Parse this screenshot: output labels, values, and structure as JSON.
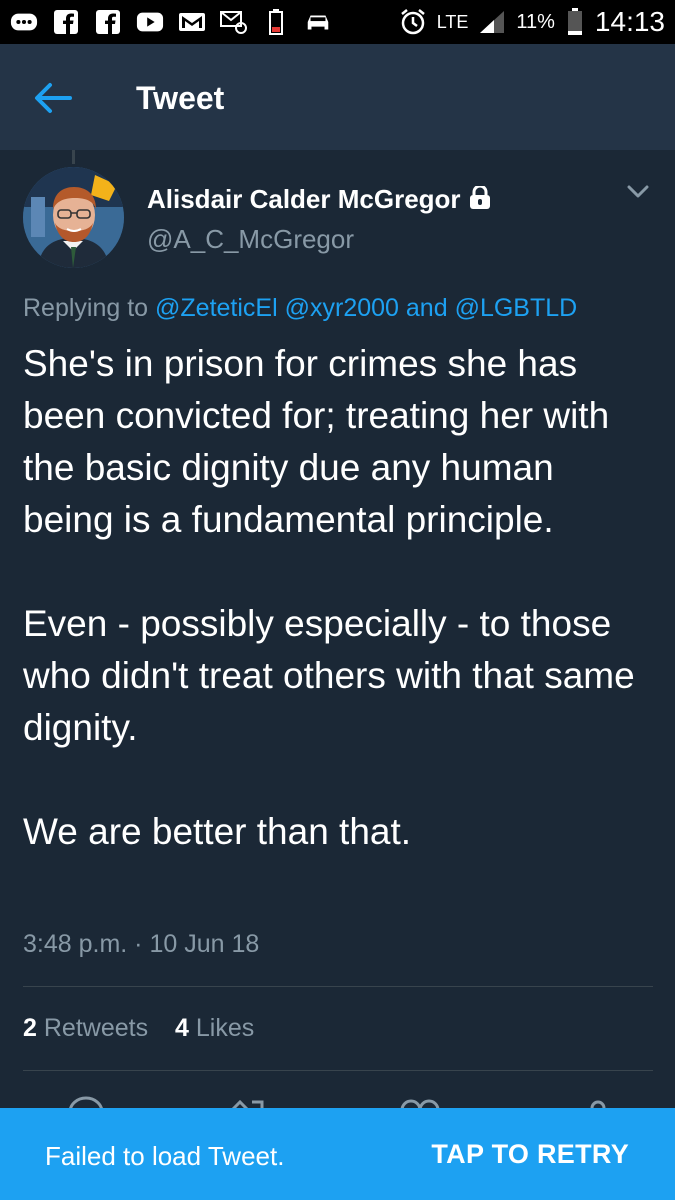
{
  "status_bar": {
    "network": "LTE",
    "battery": "11%",
    "time": "14:13",
    "icons": [
      "chat-bubble-icon",
      "facebook-icon",
      "facebook-icon",
      "youtube-icon",
      "gmail-icon",
      "email-settings-icon",
      "battery-low-icon",
      "car-icon",
      "alarm-icon",
      "signal-icon",
      "battery-icon"
    ]
  },
  "app_bar": {
    "title": "Tweet",
    "back_icon": "back-arrow-icon"
  },
  "tweet": {
    "author_name": "Alisdair Calder McGregor",
    "author_handle": "@A_C_McGregor",
    "replying_prefix": "Replying to",
    "mentions": [
      "@ZeteticEl",
      "@xyr2000"
    ],
    "mention_joiner": "and",
    "mention_last": "@LGBTLD",
    "paragraphs": [
      "She's in prison for crimes she has been convicted for; treating her with the basic dignity due any human being is a fundamental principle.",
      "Even - possibly especially - to those who didn't treat others with that same dignity.",
      "We are better than that."
    ],
    "timestamp": "3:48 p.m. · 10 Jun 18",
    "retweets_count": "2",
    "retweets_label": "Retweets",
    "likes_count": "4",
    "likes_label": "Likes"
  },
  "snackbar": {
    "message": "Failed to load Tweet.",
    "action": "TAP TO RETRY"
  },
  "colors": {
    "background": "#1b2836",
    "app_bar": "#243447",
    "accent": "#1da1f2",
    "secondary_text": "#8899a6",
    "divider": "#38444d"
  }
}
